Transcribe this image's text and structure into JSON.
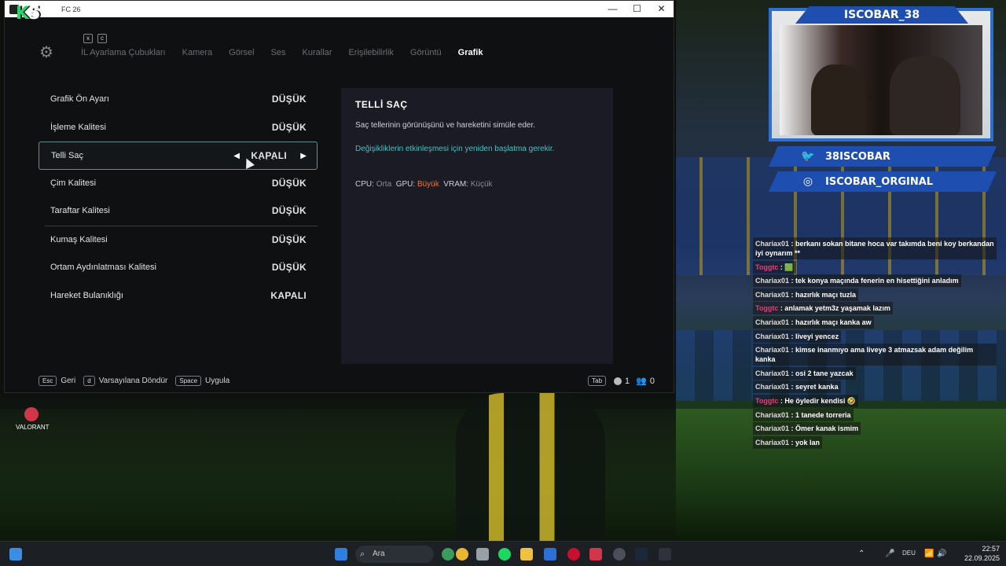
{
  "window": {
    "title": "FC 26",
    "min": "—",
    "max": "☐",
    "close": "✕"
  },
  "logo": {
    "k": "K",
    "five": "5"
  },
  "keyhints": {
    "left": "x",
    "right": "c"
  },
  "tabs": [
    "İL Ayarlama Çubukları",
    "Kamera",
    "Görsel",
    "Ses",
    "Kurallar",
    "Erişilebilirlik",
    "Görüntü",
    "Grafik"
  ],
  "active_tab": "Grafik",
  "settings": [
    {
      "label": "Grafik Ön Ayarı",
      "value": "DÜŞÜK"
    },
    {
      "label": "İşleme Kalitesi",
      "value": "DÜŞÜK"
    },
    {
      "label": "Telli Saç",
      "value": "KAPALI"
    },
    {
      "label": "Çim Kalitesi",
      "value": "DÜŞÜK"
    },
    {
      "label": "Taraftar Kalitesi",
      "value": "DÜŞÜK"
    },
    {
      "label": "Kumaş Kalitesi",
      "value": "DÜŞÜK"
    },
    {
      "label": "Ortam Aydınlatması Kalitesi",
      "value": "DÜŞÜK"
    },
    {
      "label": "Hareket Bulanıklığı",
      "value": "KAPALI"
    }
  ],
  "selected_arrows": {
    "left": "◀",
    "right": "▶",
    "dots": "• • •"
  },
  "panel": {
    "title": "TELLİ SAÇ",
    "description": "Saç tellerinin görünüşünü ve hareketini simüle eder.",
    "warning": "Değişikliklerin etkinleşmesi için yeniden başlatma gerekir.",
    "cpu_label": "CPU:",
    "cpu_value": "Orta",
    "gpu_label": "GPU:",
    "gpu_value": "Büyük",
    "vram_label": "VRAM:",
    "vram_value": "Küçük"
  },
  "footer": [
    {
      "key": "Esc",
      "label": "Geri"
    },
    {
      "key": "d",
      "label": "Varsayılana Döndür"
    },
    {
      "key": "Space",
      "label": "Uygula"
    }
  ],
  "status": {
    "tab_key": "Tab",
    "coins": "1",
    "friends": "0"
  },
  "desktop_icon": {
    "label": "VALORANT"
  },
  "stream": {
    "cam_name": "ISCOBAR_38",
    "twitter": "38ISCOBAR",
    "instagram": "ISCOBAR_ORGINAL"
  },
  "chat": [
    {
      "user": "Chariax01",
      "text": "berkanı sokan bitane hoca var takımda beni koy berkandan iyi oynarım **"
    },
    {
      "user": "Toggtc",
      "text": "🟩",
      "pink": true
    },
    {
      "user": "Chariax01",
      "text": "tek konya maçında fenerin en hisettiğini anladım"
    },
    {
      "user": "Chariax01",
      "text": "hazırlık maçı tuzla"
    },
    {
      "user": "Toggtc",
      "text": "anlamak yetm3z yaşamak lazım",
      "pink": true
    },
    {
      "user": "Chariax01",
      "text": "hazırlık maçı kanka aw"
    },
    {
      "user": "Chariax01",
      "text": "liveyi yencez"
    },
    {
      "user": "Chariax01",
      "text": "kimse inanmıyo ama liveye 3 atmazsak adam değilim kanka"
    },
    {
      "user": "Chariax01",
      "text": "osi 2 tane yazcak"
    },
    {
      "user": "Chariax01",
      "text": "seyret kanka"
    },
    {
      "user": "Toggtc",
      "text": "He öyledir kendisi 🤣",
      "pink": true
    },
    {
      "user": "Chariax01",
      "text": "1 tanede torreria"
    },
    {
      "user": "Chariax01",
      "text": "Ömer kanak ismim"
    },
    {
      "user": "Chariax01",
      "text": "yok lan"
    }
  ],
  "taskbar": {
    "search": "Ara",
    "lang": "DEU",
    "time": "22:57",
    "date": "22.09.2025"
  },
  "colors": {
    "accent": "#30d36b",
    "warning": "#3ec6c0",
    "gpu_high": "#e07b36",
    "brand_blue": "#1e4fb0"
  }
}
